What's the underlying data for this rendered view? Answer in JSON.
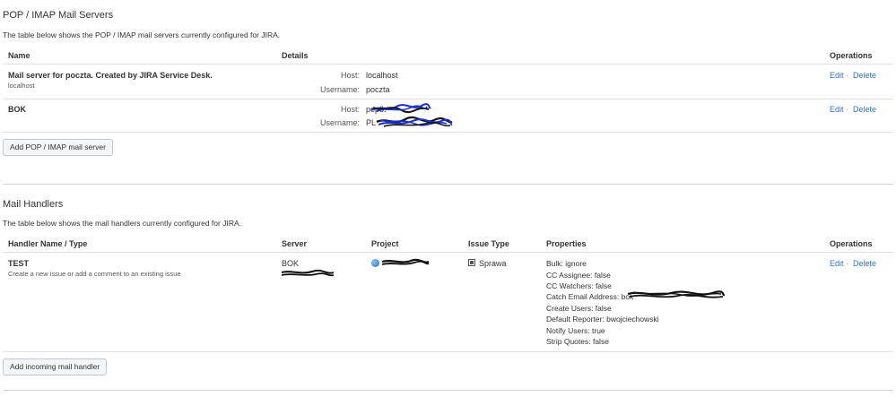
{
  "pop": {
    "title": "POP / IMAP Mail Servers",
    "description": "The table below shows the POP / IMAP mail servers currently configured for JIRA.",
    "headers": {
      "name": "Name",
      "details": "Details",
      "operations": "Operations"
    },
    "rows": [
      {
        "name": "Mail server for poczta. Created by JIRA Service Desk.",
        "subname": "localhost",
        "host_label": "Host:",
        "host_value": "localhost",
        "username_label": "Username:",
        "username_value": "poczta",
        "edit": "Edit",
        "delete": "Delete"
      },
      {
        "name": "BOK",
        "host_label": "Host:",
        "host_value": "pop3.",
        "username_label": "Username:",
        "username_value": "PL",
        "edit": "Edit",
        "delete": "Delete"
      }
    ],
    "add_button": "Add POP / IMAP mail server"
  },
  "handlers": {
    "title": "Mail Handlers",
    "description": "The table below shows the mail handlers currently configured for JIRA.",
    "headers": {
      "name": "Handler Name / Type",
      "server": "Server",
      "project": "Project",
      "issue_type": "Issue Type",
      "properties": "Properties",
      "operations": "Operations"
    },
    "rows": [
      {
        "name": "TEST",
        "type": "Create a new issue or add a comment to an existing issue",
        "server": "BOK",
        "issue_type": "Sprawa",
        "properties": [
          "Bulk: ignore",
          "CC Assignee: false",
          "CC Watchers: false",
          "Catch Email Address: bok",
          "Create Users: false",
          "Default Reporter: bwojciechowski",
          "Notify Users: true",
          "Strip Quotes: false"
        ],
        "edit": "Edit",
        "delete": "Delete"
      }
    ],
    "add_button": "Add incoming mail handler"
  },
  "separator": "·",
  "icons": {
    "project": "project-avatar-icon",
    "issue_type": "issue-type-icon"
  },
  "colors": {
    "link": "#3572b0",
    "redaction_dark": "#111111",
    "redaction_blue": "#1a2fc9"
  }
}
